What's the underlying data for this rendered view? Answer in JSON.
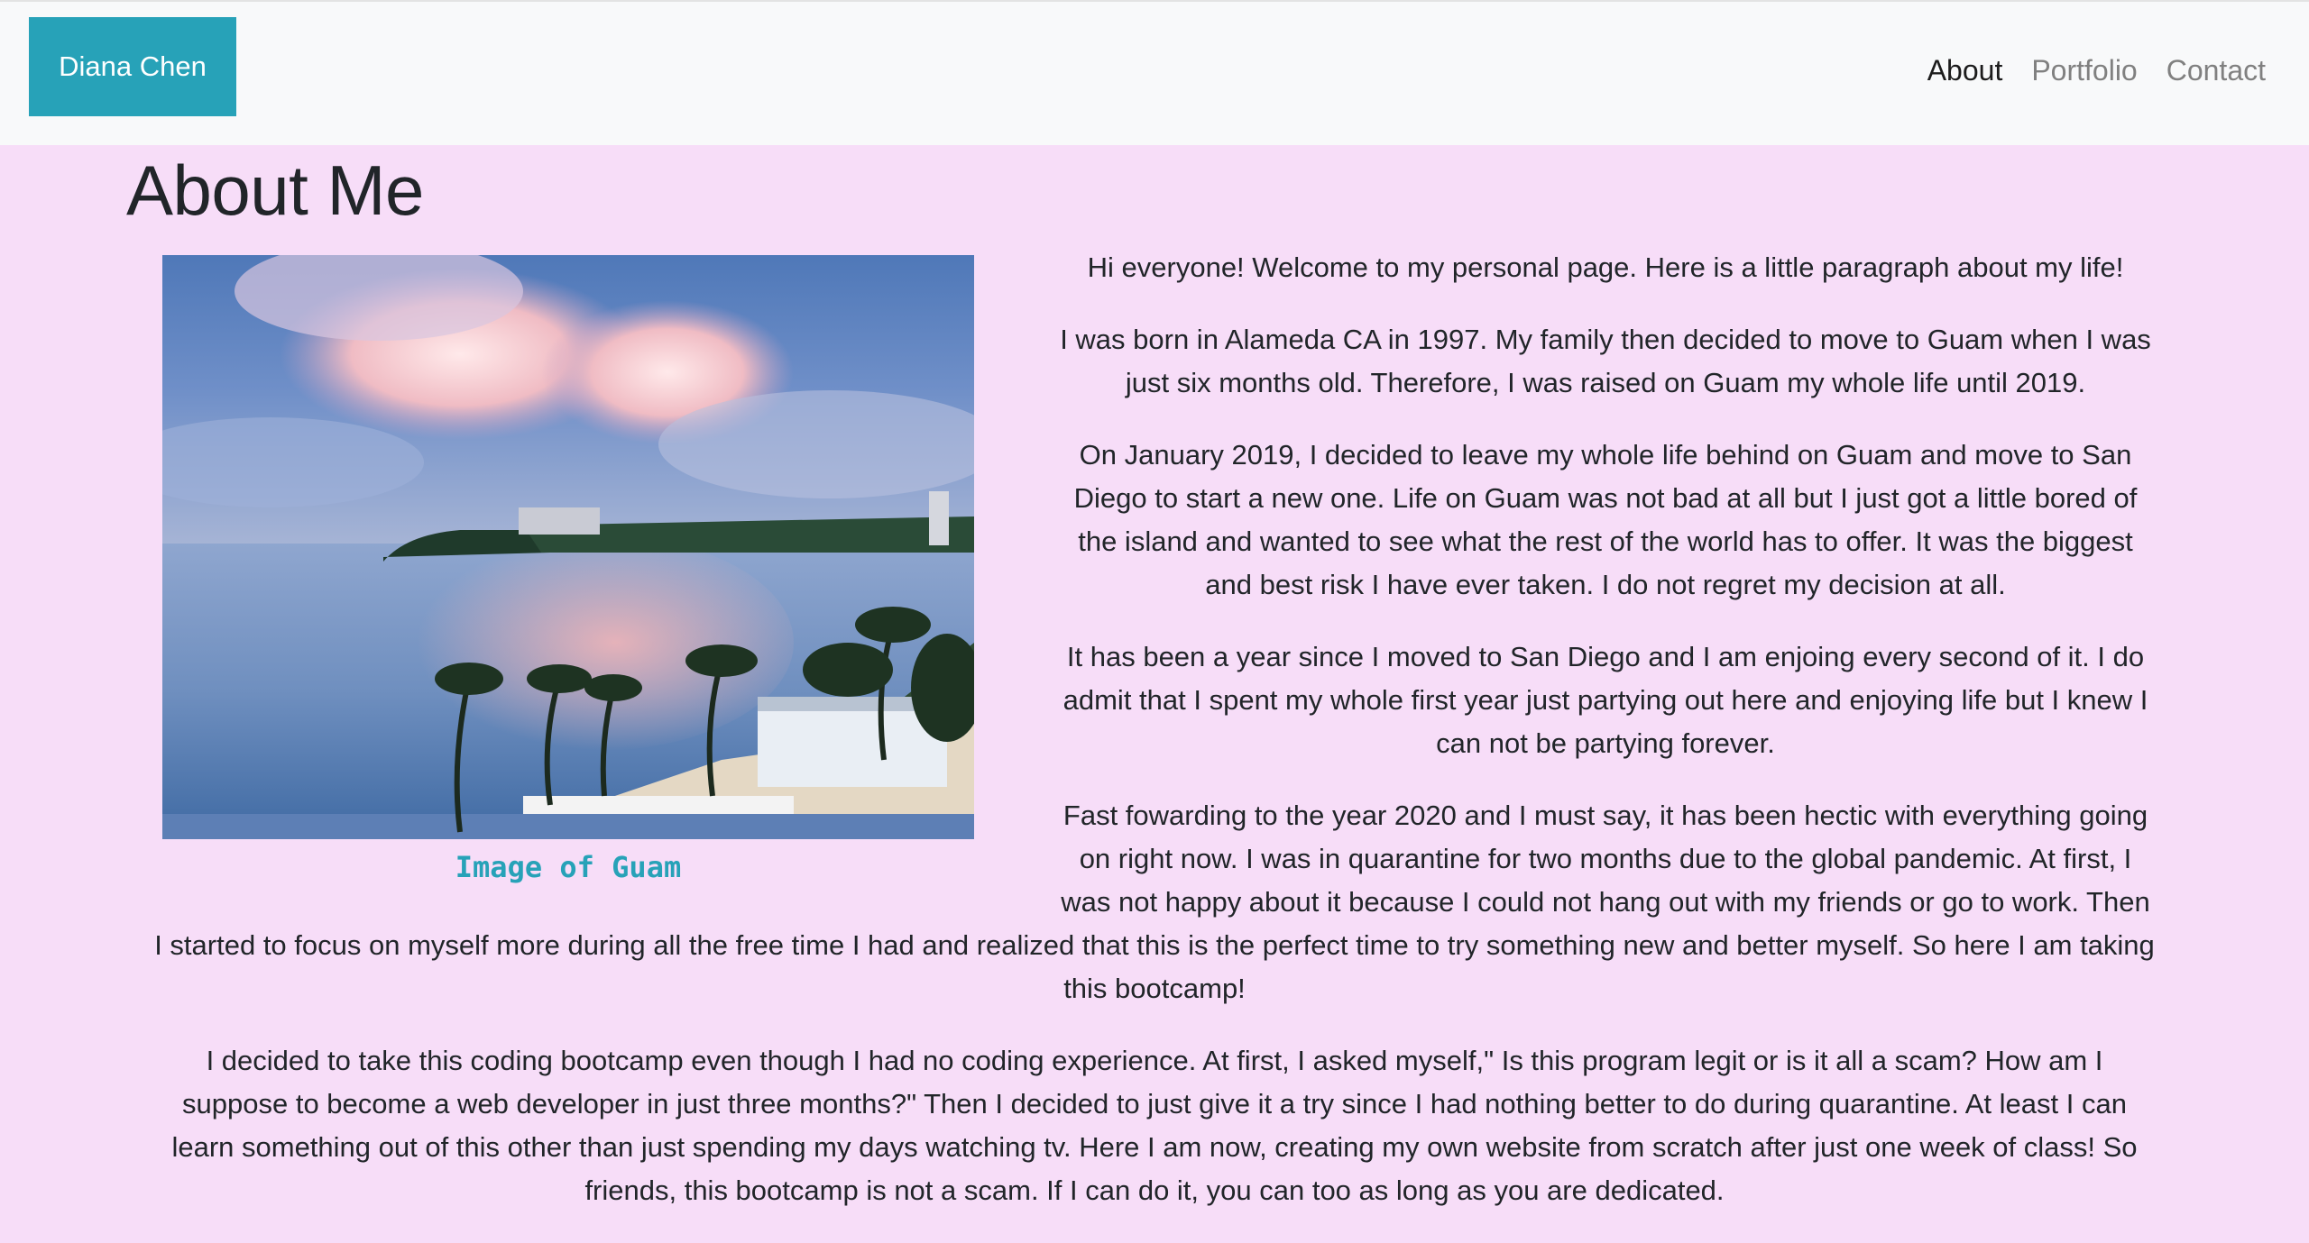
{
  "nav": {
    "brand": "Diana Chen",
    "links": [
      {
        "label": "About",
        "active": true
      },
      {
        "label": "Portfolio",
        "active": false
      },
      {
        "label": "Contact",
        "active": false
      }
    ]
  },
  "main": {
    "title": "About Me",
    "image_caption": "Image of Guam",
    "paragraphs": [
      "Hi everyone! Welcome to my personal page. Here is a little paragraph about my life!",
      "I was born in Alameda CA in 1997. My family then decided to move to Guam when I was just six months old. Therefore, I was raised on Guam my whole life until 2019.",
      "On January 2019, I decided to leave my whole life behind on Guam and move to San Diego to start a new one. Life on Guam was not bad at all but I just got a little bored of the island and wanted to see what the rest of the world has to offer. It was the biggest and best risk I have ever taken. I do not regret my decision at all.",
      "It has been a year since I moved to San Diego and I am enjoing every second of it. I do admit that I spent my whole first year just partying out here and enjoying life but I knew I can not be partying forever.",
      "Fast fowarding to the year 2020 and I must say, it has been hectic with everything going on right now. I was in quarantine for two months due to the global pandemic. At first, I was not happy about it because I could not hang out with my friends or go to work. Then I started to focus on myself more during all the free time I had and realized that this is the perfect time to try something new and better myself. So here I am taking this bootcamp!",
      "I decided to take this coding bootcamp even though I had no coding experience. At first, I asked myself,\" Is this program legit or is it all a scam? How am I suppose to become a web developer in just three months?\" Then I decided to just give it a try since I had nothing better to do during quarantine. At least I can learn something out of this other than just spending my days watching tv. Here I am now, creating my own website from scratch after just one week of class! So friends, this bootcamp is not a scam. If I can do it, you can too as long as you are dedicated."
    ]
  },
  "colors": {
    "brand_bg": "#27a2b8",
    "page_bg": "#f7ddf8",
    "navbar_bg": "#f8f9fa",
    "caption": "#27a2b8"
  }
}
